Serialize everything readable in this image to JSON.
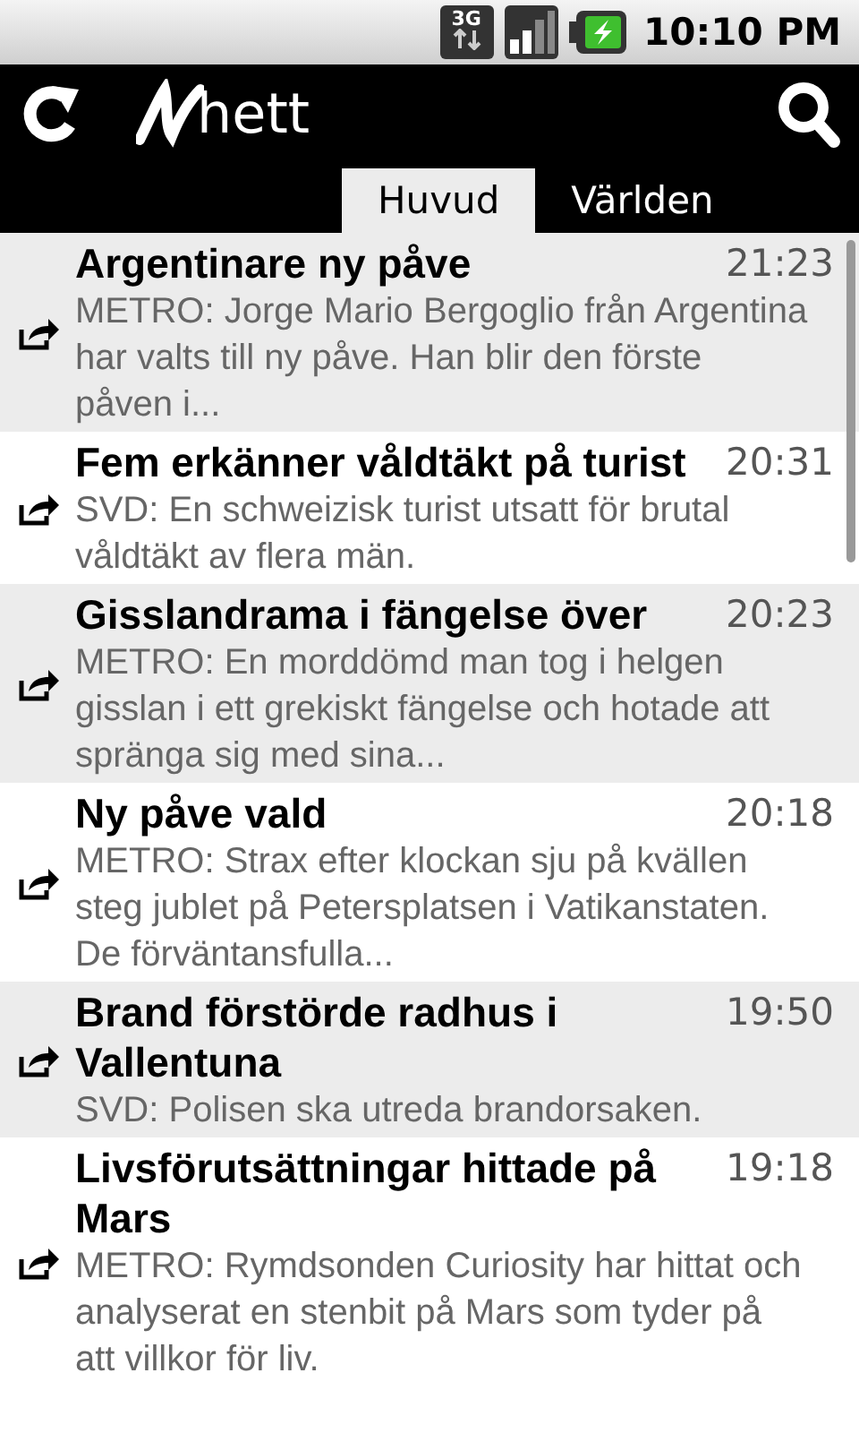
{
  "status_bar": {
    "network": "3G",
    "time": "10:10 PM"
  },
  "header": {
    "logo_text": "hett"
  },
  "tabs": [
    {
      "label": "Huvud",
      "selected": true
    },
    {
      "label": "Världen",
      "selected": false
    }
  ],
  "articles": [
    {
      "title": "Argentinare ny påve",
      "time": "21:23",
      "summary": "METRO: Jorge Mario Bergoglio från Argentina har valts till ny påve. Han blir den förste påven i..."
    },
    {
      "title": "Fem erkänner våldtäkt på turist",
      "time": "20:31",
      "summary": "SVD:  En schweizisk turist utsatt för brutal våldtäkt av flera män."
    },
    {
      "title": "Gisslandrama i fängelse över",
      "time": "20:23",
      "summary": "METRO: En morddömd man tog i helgen gisslan i ett grekiskt fängelse och hotade att spränga sig med sina..."
    },
    {
      "title": "Ny påve vald",
      "time": "20:18",
      "summary": "METRO: Strax efter klockan sju på kvällen steg jublet på Petersplatsen i Vatikanstaten. De förväntansfulla..."
    },
    {
      "title": "Brand förstörde radhus i Vallentuna",
      "time": "19:50",
      "summary": "SVD:  Polisen ska utreda brandorsaken."
    },
    {
      "title": "Livsförutsättningar hittade på Mars",
      "time": "19:18",
      "summary": "METRO: Rymdsonden Curiosity har hittat och analyserat en stenbit på Mars som tyder på att villkor för liv."
    }
  ]
}
